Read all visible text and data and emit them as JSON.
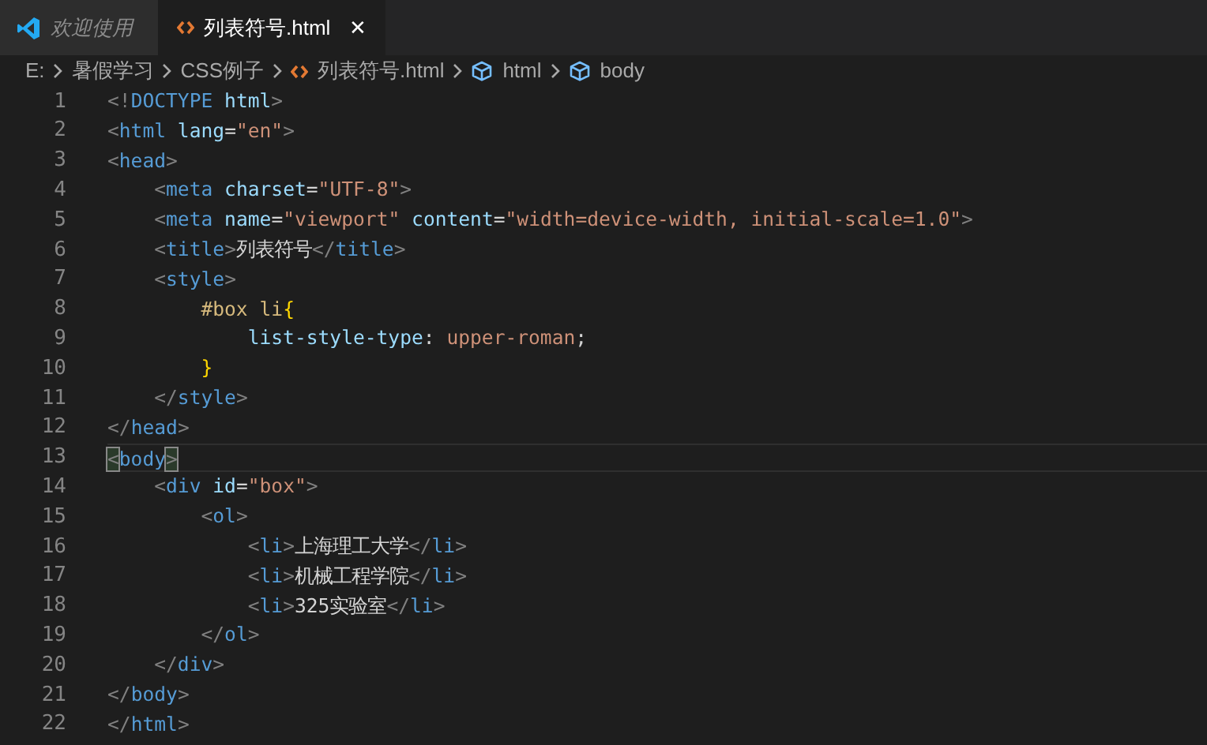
{
  "tabs": [
    {
      "label": "欢迎使用",
      "kind": "welcome",
      "selected": false,
      "closable": false
    },
    {
      "label": "列表符号.html",
      "kind": "html",
      "selected": true,
      "closable": true
    }
  ],
  "close_glyph": "✕",
  "breadcrumb": [
    {
      "label": "E:",
      "kind": "folder"
    },
    {
      "label": "暑假学习",
      "kind": "folder"
    },
    {
      "label": "CSS例子",
      "kind": "folder"
    },
    {
      "label": "列表符号.html",
      "kind": "html"
    },
    {
      "label": "html",
      "kind": "symbol"
    },
    {
      "label": "body",
      "kind": "symbol"
    }
  ],
  "lines": [
    {
      "number": "1",
      "current": false,
      "tokens": [
        {
          "kind": "punct",
          "text": "<!"
        },
        {
          "kind": "tag",
          "text": "DOCTYPE"
        },
        {
          "kind": "attr",
          "text": " html"
        },
        {
          "kind": "punct",
          "text": ">"
        }
      ]
    },
    {
      "number": "2",
      "current": false,
      "tokens": [
        {
          "kind": "punct",
          "text": "<"
        },
        {
          "kind": "tag",
          "text": "html"
        },
        {
          "kind": "attr",
          "text": " lang"
        },
        {
          "kind": "plain",
          "text": "="
        },
        {
          "kind": "string",
          "text": "\"en\""
        },
        {
          "kind": "punct",
          "text": ">"
        }
      ]
    },
    {
      "number": "3",
      "current": false,
      "tokens": [
        {
          "kind": "punct",
          "text": "<"
        },
        {
          "kind": "tag",
          "text": "head"
        },
        {
          "kind": "punct",
          "text": ">"
        }
      ]
    },
    {
      "number": "4",
      "current": false,
      "tokens": [
        {
          "kind": "punct",
          "text": "    <"
        },
        {
          "kind": "tag",
          "text": "meta"
        },
        {
          "kind": "attr",
          "text": " charset"
        },
        {
          "kind": "plain",
          "text": "="
        },
        {
          "kind": "string",
          "text": "\"UTF-8\""
        },
        {
          "kind": "punct",
          "text": ">"
        }
      ]
    },
    {
      "number": "5",
      "current": false,
      "tokens": [
        {
          "kind": "punct",
          "text": "    <"
        },
        {
          "kind": "tag",
          "text": "meta"
        },
        {
          "kind": "attr",
          "text": " name"
        },
        {
          "kind": "plain",
          "text": "="
        },
        {
          "kind": "string",
          "text": "\"viewport\""
        },
        {
          "kind": "attr",
          "text": " content"
        },
        {
          "kind": "plain",
          "text": "="
        },
        {
          "kind": "string",
          "text": "\"width=device-width, initial-scale=1.0\""
        },
        {
          "kind": "punct",
          "text": ">"
        }
      ]
    },
    {
      "number": "6",
      "current": false,
      "tokens": [
        {
          "kind": "punct",
          "text": "    <"
        },
        {
          "kind": "tag",
          "text": "title"
        },
        {
          "kind": "punct",
          "text": ">"
        },
        {
          "kind": "plain",
          "text": "列表符号"
        },
        {
          "kind": "punct",
          "text": "</"
        },
        {
          "kind": "tag",
          "text": "title"
        },
        {
          "kind": "punct",
          "text": ">"
        }
      ]
    },
    {
      "number": "7",
      "current": false,
      "tokens": [
        {
          "kind": "punct",
          "text": "    <"
        },
        {
          "kind": "tag",
          "text": "style"
        },
        {
          "kind": "punct",
          "text": ">"
        }
      ]
    },
    {
      "number": "8",
      "current": false,
      "tokens": [
        {
          "kind": "selector",
          "text": "        #box li"
        },
        {
          "kind": "brace",
          "text": "{"
        }
      ]
    },
    {
      "number": "9",
      "current": false,
      "tokens": [
        {
          "kind": "attr",
          "text": "            list-style-type"
        },
        {
          "kind": "plain",
          "text": ":"
        },
        {
          "kind": "string",
          "text": " upper-roman"
        },
        {
          "kind": "plain",
          "text": ";"
        }
      ]
    },
    {
      "number": "10",
      "current": false,
      "tokens": [
        {
          "kind": "brace",
          "text": "        }"
        }
      ]
    },
    {
      "number": "11",
      "current": false,
      "tokens": [
        {
          "kind": "punct",
          "text": "    </"
        },
        {
          "kind": "tag",
          "text": "style"
        },
        {
          "kind": "punct",
          "text": ">"
        }
      ]
    },
    {
      "number": "12",
      "current": false,
      "tokens": [
        {
          "kind": "punct",
          "text": "</"
        },
        {
          "kind": "tag",
          "text": "head"
        },
        {
          "kind": "punct",
          "text": ">"
        }
      ]
    },
    {
      "number": "13",
      "current": true,
      "tokens": [
        {
          "kind": "match",
          "text": "<"
        },
        {
          "kind": "tag",
          "text": "body"
        },
        {
          "kind": "match",
          "text": ">"
        }
      ]
    },
    {
      "number": "14",
      "current": false,
      "tokens": [
        {
          "kind": "punct",
          "text": "    <"
        },
        {
          "kind": "tag",
          "text": "div"
        },
        {
          "kind": "attr",
          "text": " id"
        },
        {
          "kind": "plain",
          "text": "="
        },
        {
          "kind": "string",
          "text": "\"box\""
        },
        {
          "kind": "punct",
          "text": ">"
        }
      ]
    },
    {
      "number": "15",
      "current": false,
      "tokens": [
        {
          "kind": "punct",
          "text": "        <"
        },
        {
          "kind": "tag",
          "text": "ol"
        },
        {
          "kind": "punct",
          "text": ">"
        }
      ]
    },
    {
      "number": "16",
      "current": false,
      "tokens": [
        {
          "kind": "punct",
          "text": "            <"
        },
        {
          "kind": "tag",
          "text": "li"
        },
        {
          "kind": "punct",
          "text": ">"
        },
        {
          "kind": "plain",
          "text": "上海理工大学"
        },
        {
          "kind": "punct",
          "text": "</"
        },
        {
          "kind": "tag",
          "text": "li"
        },
        {
          "kind": "punct",
          "text": ">"
        }
      ]
    },
    {
      "number": "17",
      "current": false,
      "tokens": [
        {
          "kind": "punct",
          "text": "            <"
        },
        {
          "kind": "tag",
          "text": "li"
        },
        {
          "kind": "punct",
          "text": ">"
        },
        {
          "kind": "plain",
          "text": "机械工程学院"
        },
        {
          "kind": "punct",
          "text": "</"
        },
        {
          "kind": "tag",
          "text": "li"
        },
        {
          "kind": "punct",
          "text": ">"
        }
      ]
    },
    {
      "number": "18",
      "current": false,
      "tokens": [
        {
          "kind": "punct",
          "text": "            <"
        },
        {
          "kind": "tag",
          "text": "li"
        },
        {
          "kind": "punct",
          "text": ">"
        },
        {
          "kind": "plain",
          "text": "325实验室"
        },
        {
          "kind": "punct",
          "text": "</"
        },
        {
          "kind": "tag",
          "text": "li"
        },
        {
          "kind": "punct",
          "text": ">"
        }
      ]
    },
    {
      "number": "19",
      "current": false,
      "tokens": [
        {
          "kind": "punct",
          "text": "        </"
        },
        {
          "kind": "tag",
          "text": "ol"
        },
        {
          "kind": "punct",
          "text": ">"
        }
      ]
    },
    {
      "number": "20",
      "current": false,
      "tokens": [
        {
          "kind": "punct",
          "text": "    </"
        },
        {
          "kind": "tag",
          "text": "div"
        },
        {
          "kind": "punct",
          "text": ">"
        }
      ]
    },
    {
      "number": "21",
      "current": false,
      "tokens": [
        {
          "kind": "punct",
          "text": "</"
        },
        {
          "kind": "tag",
          "text": "body"
        },
        {
          "kind": "punct",
          "text": ">"
        }
      ]
    },
    {
      "number": "22",
      "current": false,
      "tokens": [
        {
          "kind": "punct",
          "text": "</"
        },
        {
          "kind": "tag",
          "text": "html"
        },
        {
          "kind": "punct",
          "text": ">"
        }
      ]
    }
  ]
}
